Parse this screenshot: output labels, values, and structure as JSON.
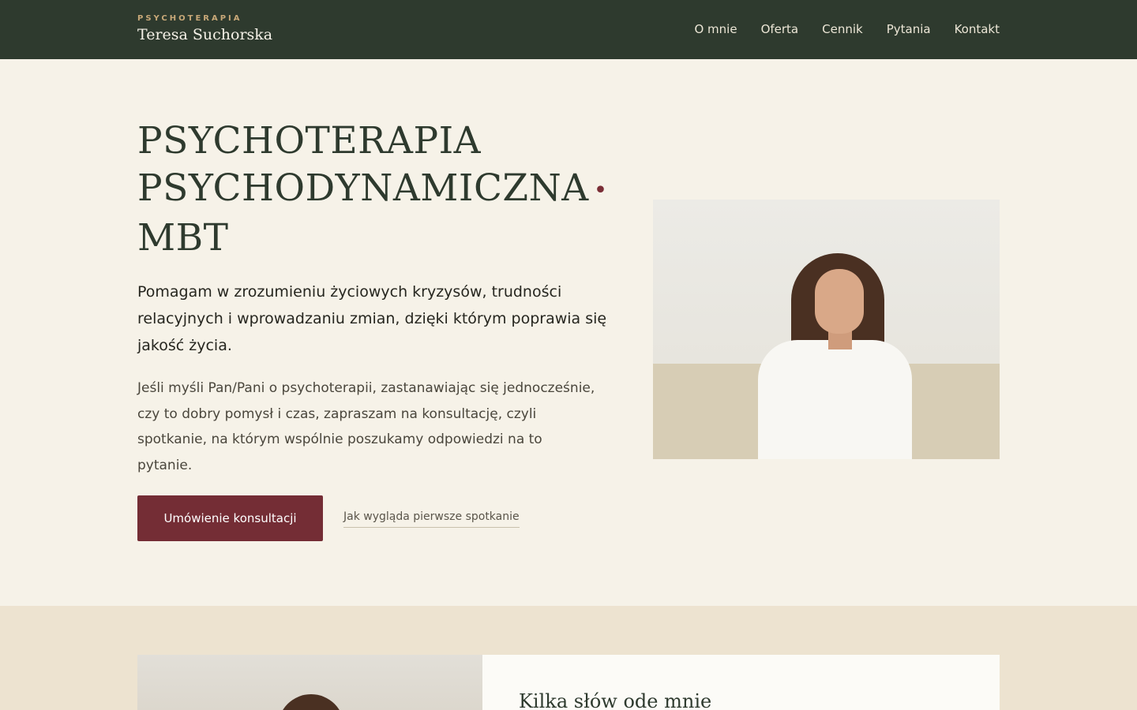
{
  "header": {
    "kicker": "PSYCHOTERAPIA",
    "name": "Teresa Suchorska",
    "nav": [
      "O mnie",
      "Oferta",
      "Cennik",
      "Pytania",
      "Kontakt"
    ]
  },
  "hero": {
    "title_line1": "PSYCHOTERAPIA",
    "title_line2": "PSYCHODYNAMICZNA",
    "title_dot": "•",
    "title_line3": "MBT",
    "lead": "Pomagam w zrozumieniu życiowych kryzysów, trudności relacyjnych i wprowadzaniu zmian, dzięki którym poprawia się jakość życia.",
    "body": "Jeśli myśli Pan/Pani o psychoterapii, zastanawiając się jednocześnie, czy to dobry pomysł i czas, zapraszam na konsultację, czyli spotkanie, na którym wspólnie poszukamy odpowiedzi na to pytanie.",
    "cta_button": "Umówienie konsultacji",
    "cta_link": "Jak wygląda pierwsze spotkanie"
  },
  "about": {
    "title": "Kilka słów ode mnie"
  },
  "colors": {
    "header_bg": "#2e3a2e",
    "page_bg": "#f6f2e8",
    "accent": "#742d35",
    "section_bg": "#ede3d0"
  }
}
